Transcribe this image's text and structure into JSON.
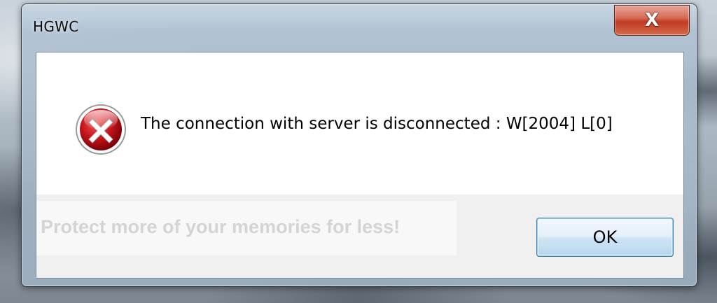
{
  "window": {
    "title": "HGWC",
    "close_glyph": "X"
  },
  "dialog": {
    "icon": "error-icon",
    "message": "The connection with server is disconnected : W[2004] L[0]",
    "ok_label": "OK"
  },
  "overlay": {
    "watermark": "Protect more of your memories for less!"
  },
  "colors": {
    "close_button": "#c8452c",
    "error_icon": "#c8141c",
    "ok_border": "#3c7fb1"
  }
}
